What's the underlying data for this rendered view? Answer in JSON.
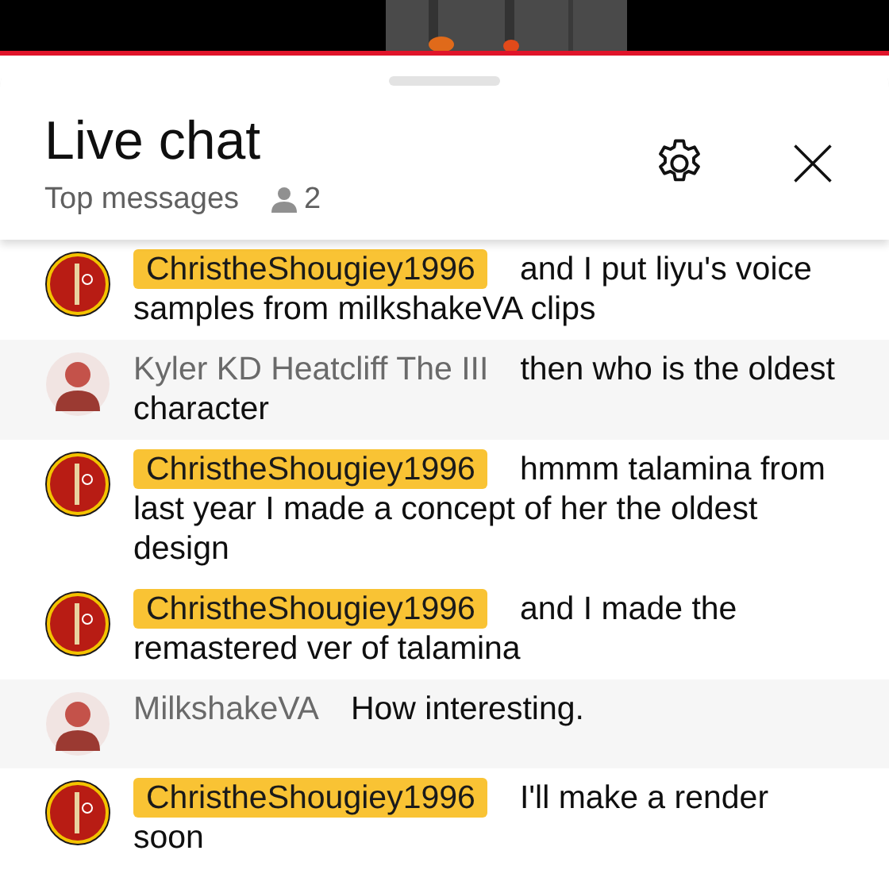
{
  "video": {
    "progress": {
      "level": 1
    }
  },
  "header": {
    "title": "Live chat",
    "mode": "Top messages",
    "viewers": "2"
  },
  "messages": [
    {
      "author": "ChristheShougiey1996",
      "text": "and I put liyu's voice samples from milkshakeVA clips",
      "kind": "owner"
    },
    {
      "author": "Kyler KD Heatcliff The III",
      "text": "then who is the oldest character",
      "kind": "viewer"
    },
    {
      "author": "ChristheShougiey1996",
      "text": "hmmm talamina from last year I made a concept of her the oldest design",
      "kind": "owner"
    },
    {
      "author": "ChristheShougiey1996",
      "text": "and I made the remastered ver of talamina",
      "kind": "owner"
    },
    {
      "author": "MilkshakeVA",
      "text": "How interesting.",
      "kind": "viewer"
    },
    {
      "author": "ChristheShougiey1996",
      "text": "I'll make a render soon",
      "kind": "owner"
    }
  ]
}
